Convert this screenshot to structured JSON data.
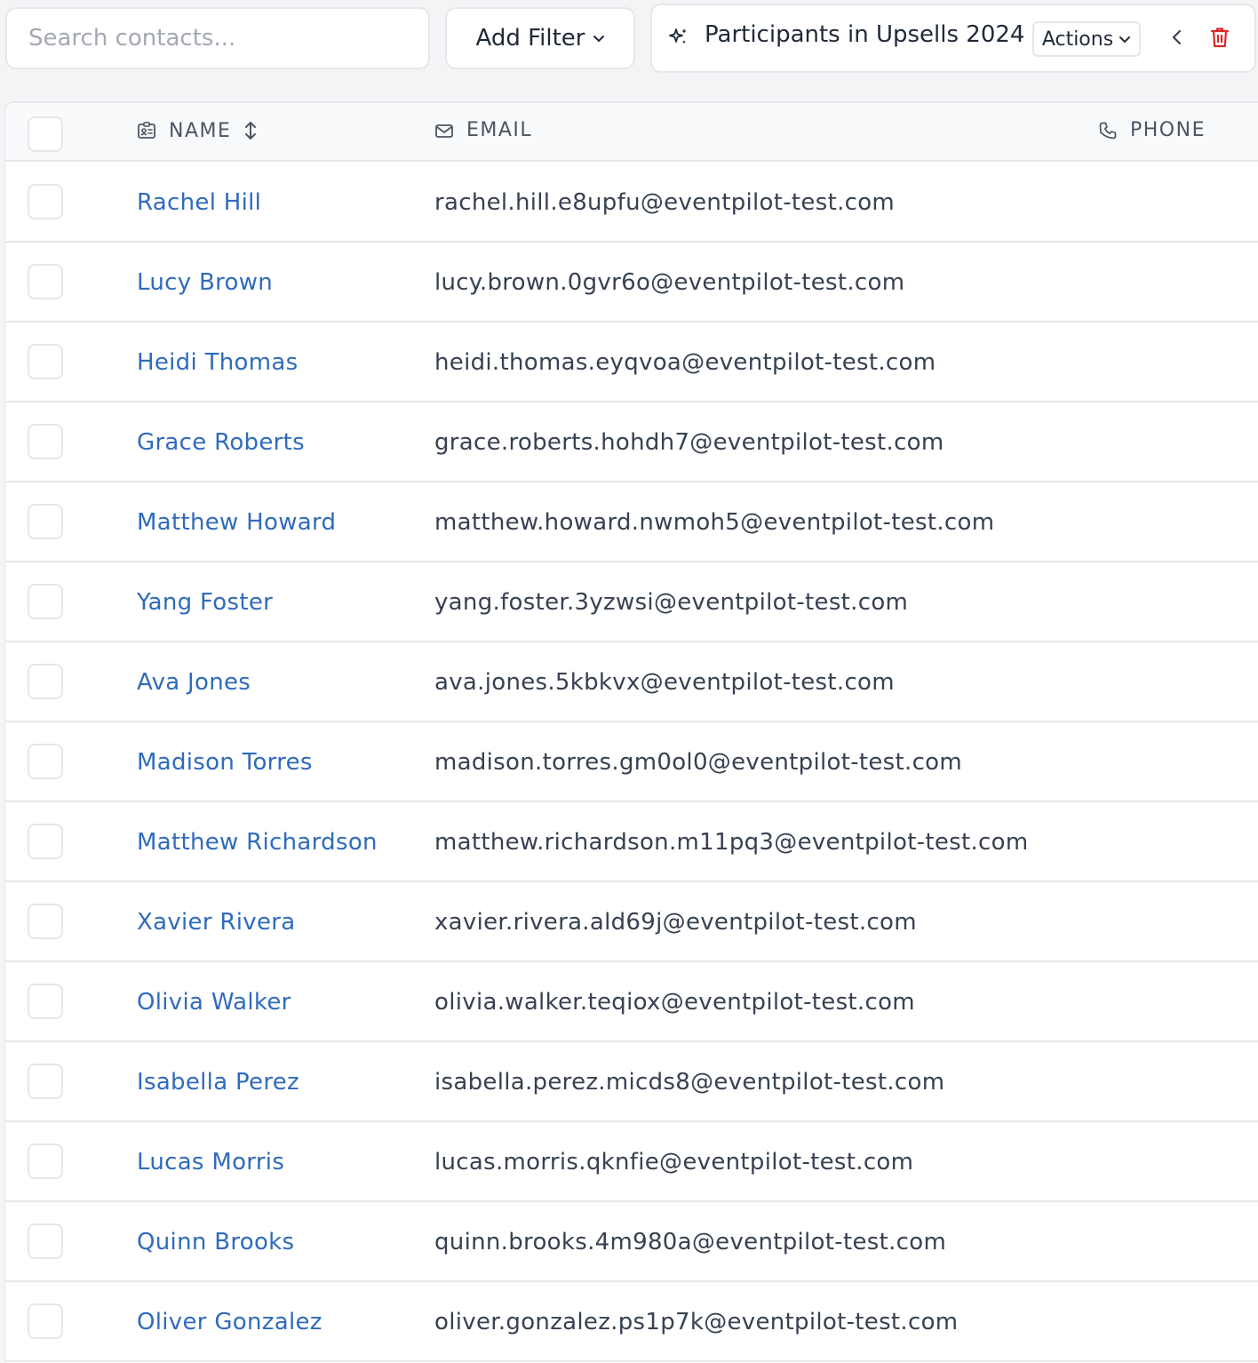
{
  "toolbar": {
    "search_placeholder": "Search contacts...",
    "filter_label": "Add Filter",
    "view_title": "Participants in Upsells 2024",
    "actions_label": "Actions"
  },
  "table": {
    "columns": {
      "name": "NAME",
      "email": "EMAIL",
      "phone": "PHONE"
    },
    "rows": [
      {
        "name": "Rachel Hill",
        "email": "rachel.hill.e8upfu@eventpilot-test.com"
      },
      {
        "name": "Lucy Brown",
        "email": "lucy.brown.0gvr6o@eventpilot-test.com"
      },
      {
        "name": "Heidi Thomas",
        "email": "heidi.thomas.eyqvoa@eventpilot-test.com"
      },
      {
        "name": "Grace Roberts",
        "email": "grace.roberts.hohdh7@eventpilot-test.com"
      },
      {
        "name": "Matthew Howard",
        "email": "matthew.howard.nwmoh5@eventpilot-test.com"
      },
      {
        "name": "Yang Foster",
        "email": "yang.foster.3yzwsi@eventpilot-test.com"
      },
      {
        "name": "Ava Jones",
        "email": "ava.jones.5kbkvx@eventpilot-test.com"
      },
      {
        "name": "Madison Torres",
        "email": "madison.torres.gm0ol0@eventpilot-test.com"
      },
      {
        "name": "Matthew Richardson",
        "email": "matthew.richardson.m11pq3@eventpilot-test.com"
      },
      {
        "name": "Xavier Rivera",
        "email": "xavier.rivera.ald69j@eventpilot-test.com"
      },
      {
        "name": "Olivia Walker",
        "email": "olivia.walker.teqiox@eventpilot-test.com"
      },
      {
        "name": "Isabella Perez",
        "email": "isabella.perez.micds8@eventpilot-test.com"
      },
      {
        "name": "Lucas Morris",
        "email": "lucas.morris.qknfie@eventpilot-test.com"
      },
      {
        "name": "Quinn Brooks",
        "email": "quinn.brooks.4m980a@eventpilot-test.com"
      },
      {
        "name": "Oliver Gonzalez",
        "email": "oliver.gonzalez.ps1p7k@eventpilot-test.com"
      }
    ]
  },
  "icons": {
    "sparkle": "sparkle-icon",
    "chevron": "chevron-down-icon",
    "back": "chevron-left-icon",
    "delete": "trash-icon",
    "name_col": "id-card-icon",
    "sort": "sort-icon",
    "email_col": "envelope-icon",
    "phone_col": "phone-icon"
  },
  "colors": {
    "link": "#2f6bbd",
    "delete": "#dc2626",
    "border": "#e5e7eb"
  }
}
